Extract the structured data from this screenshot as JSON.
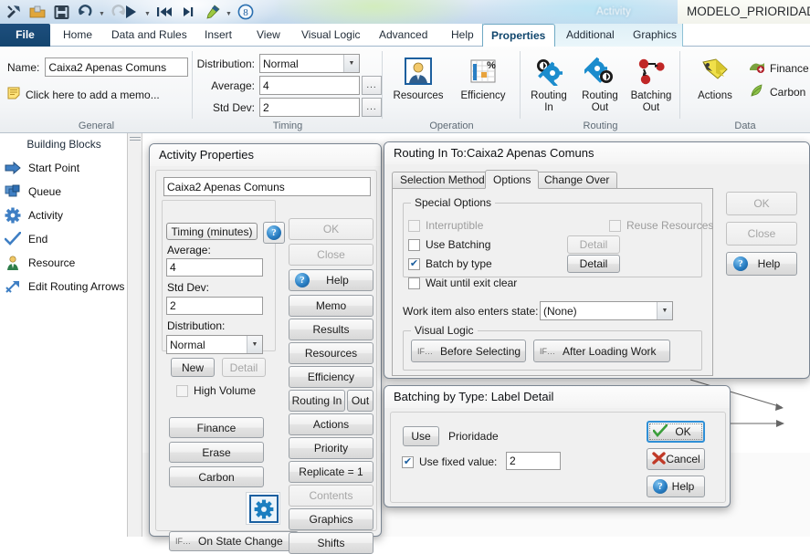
{
  "titlebar": {
    "document_title": "MODELO_PRIORIDADE_",
    "context_group": "Activity",
    "quick_access": [
      {
        "name": "customize-icon",
        "label": "Customize"
      },
      {
        "name": "open-icon",
        "label": "Open"
      },
      {
        "name": "save-icon",
        "label": "Save"
      },
      {
        "name": "undo-icon",
        "label": "Undo"
      },
      {
        "name": "redo-icon",
        "label": "Redo"
      },
      {
        "name": "run-icon",
        "label": "Run"
      },
      {
        "name": "reset-icon",
        "label": "Reset to start"
      },
      {
        "name": "step-end-icon",
        "label": "Go to end"
      },
      {
        "name": "highlight-icon",
        "label": "Highlight"
      },
      {
        "name": "clock-icon",
        "label": "8"
      }
    ],
    "clock_value": "8"
  },
  "ribbon": {
    "tabs": [
      {
        "label": "File",
        "selected": false,
        "file": true
      },
      {
        "label": "Home",
        "selected": false
      },
      {
        "label": "Data and Rules",
        "selected": false
      },
      {
        "label": "Insert",
        "selected": false
      },
      {
        "label": "View",
        "selected": false
      },
      {
        "label": "Visual Logic",
        "selected": false
      },
      {
        "label": "Advanced",
        "selected": false
      },
      {
        "label": "Help",
        "selected": false
      },
      {
        "label": "Properties",
        "selected": true
      },
      {
        "label": "Additional",
        "selected": false
      },
      {
        "label": "Graphics",
        "selected": false
      }
    ],
    "groups": {
      "general": {
        "label": "General",
        "name_label": "Name:",
        "name_value": "Caixa2 Apenas Comuns",
        "memo_label": "Click here to add a memo..."
      },
      "timing": {
        "label": "Timing",
        "distribution_label": "Distribution:",
        "distribution_value": "Normal",
        "average_label": "Average:",
        "average_value": "4",
        "stddev_label": "Std Dev:",
        "stddev_value": "2",
        "ellipsis": "..."
      },
      "operation": {
        "label": "Operation",
        "buttons": [
          {
            "label": "Resources",
            "icon": "resource-person-icon"
          },
          {
            "label": "Efficiency",
            "icon": "efficiency-chart-icon"
          }
        ]
      },
      "routing": {
        "label": "Routing",
        "buttons": [
          {
            "label": "Routing\nIn",
            "line1": "Routing",
            "line2": "In",
            "icon": "routing-in-gear-icon"
          },
          {
            "label": "Routing\nOut",
            "line1": "Routing",
            "line2": "Out",
            "icon": "routing-out-gear-icon"
          },
          {
            "label": "Batching\nOut",
            "line1": "Batching",
            "line2": "Out",
            "icon": "batching-out-icon"
          }
        ]
      },
      "data": {
        "label": "Data",
        "actions_label": "Actions",
        "finance_label": "Finance",
        "carbon_label": "Carbon"
      }
    }
  },
  "left_panel": {
    "header": "Building Blocks",
    "items": [
      {
        "label": "Start Point",
        "icon": "start-point-arrow-icon"
      },
      {
        "label": "Queue",
        "icon": "queue-stack-icon"
      },
      {
        "label": "Activity",
        "icon": "activity-gear-icon"
      },
      {
        "label": "End",
        "icon": "end-checkmark-icon"
      },
      {
        "label": "Resource",
        "icon": "resource-person-icon"
      },
      {
        "label": "Edit Routing Arrows",
        "icon": "routing-arrows-icon"
      }
    ]
  },
  "activity_dialog": {
    "title": "Activity Properties",
    "name_value": "Caixa2 Apenas Comuns",
    "timing_button": "Timing (minutes)",
    "average_label": "Average:",
    "average_value": "4",
    "stddev_label": "Std Dev:",
    "stddev_value": "2",
    "distribution_label": "Distribution:",
    "distribution_value": "Normal",
    "new_button": "New",
    "detail_button": "Detail",
    "high_volume_label": "High Volume",
    "high_volume_checked": false,
    "left_buttons": [
      "Finance",
      "Erase",
      "Carbon"
    ],
    "on_state_change": "On State Change",
    "right_buttons": [
      {
        "label": "OK",
        "disabled": true
      },
      {
        "label": "Close",
        "disabled": true
      },
      {
        "label": "Help",
        "disabled": false,
        "icon": "help-icon"
      },
      {
        "label": "Memo",
        "disabled": false
      },
      {
        "label": "Results",
        "disabled": false
      },
      {
        "label": "Resources",
        "disabled": false
      },
      {
        "label": "Efficiency",
        "disabled": false
      }
    ],
    "routing_in": "Routing In",
    "routing_out": "Out",
    "actions": "Actions",
    "priority": "Priority",
    "replicate": "Replicate = 1",
    "contents": "Contents",
    "contents_disabled": true,
    "graphics": "Graphics",
    "shifts": "Shifts",
    "gear_icon": "activity-gear-icon"
  },
  "routing_dialog": {
    "title": "Routing In To:Caixa2 Apenas Comuns",
    "tabs": [
      {
        "label": "Selection Method",
        "selected": false
      },
      {
        "label": "Options",
        "selected": true
      },
      {
        "label": "Change Over",
        "selected": false
      }
    ],
    "special_options_label": "Special Options",
    "checkboxes": [
      {
        "label": "Interruptible",
        "checked": false,
        "disabled": true
      },
      {
        "label": "Reuse Resources",
        "checked": false,
        "disabled": true
      },
      {
        "label": "Use Batching",
        "checked": false,
        "disabled": false
      },
      {
        "label": "Batch by type",
        "checked": true,
        "disabled": false
      },
      {
        "label": "Wait until exit clear",
        "checked": false,
        "disabled": false
      }
    ],
    "detail_button_1": "Detail",
    "detail_button_1_disabled": true,
    "detail_button_2": "Detail",
    "detail_button_2_disabled": false,
    "work_item_label": "Work item also enters state:",
    "work_item_value": "(None)",
    "visual_logic_label": "Visual Logic",
    "before_selecting": "Before Selecting",
    "after_loading_work": "After Loading Work",
    "buttons": [
      {
        "label": "OK",
        "disabled": true
      },
      {
        "label": "Close",
        "disabled": true
      },
      {
        "label": "Help",
        "disabled": false,
        "icon": "help-icon"
      }
    ]
  },
  "batch_dialog": {
    "title": "Batching by Type: Label Detail",
    "use_button": "Use",
    "label_name": "Prioridade",
    "use_fixed_value_label": "Use fixed value:",
    "use_fixed_value_checked": true,
    "fixed_value": "2",
    "ok_button": "OK",
    "cancel_button": "Cancel",
    "help_button": "Help"
  },
  "colors": {
    "file_tab": "#14456f",
    "accent_blue": "#1b5e9e",
    "ok_green": "#3b9e3b",
    "cancel_red": "#c03a28",
    "gear_blue": "#1b8ccd"
  }
}
